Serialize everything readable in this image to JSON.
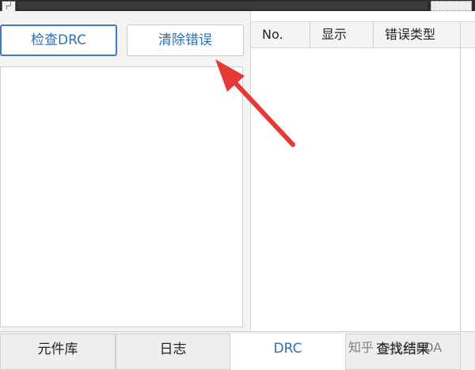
{
  "toolbar": {
    "corner_label": "┌┘"
  },
  "left_panel": {
    "check_drc_label": "检查DRC",
    "clear_errors_label": "清除错误"
  },
  "table": {
    "columns": [
      "No.",
      "显示",
      "错误类型"
    ]
  },
  "tabs": [
    {
      "label": "元件库"
    },
    {
      "label": "日志"
    },
    {
      "label": "DRC",
      "active": true
    },
    {
      "label": "查找结果"
    }
  ],
  "watermark": "知乎 @立创EDA",
  "colors": {
    "accent": "#2f6fb0",
    "arrow": "#e53935"
  }
}
